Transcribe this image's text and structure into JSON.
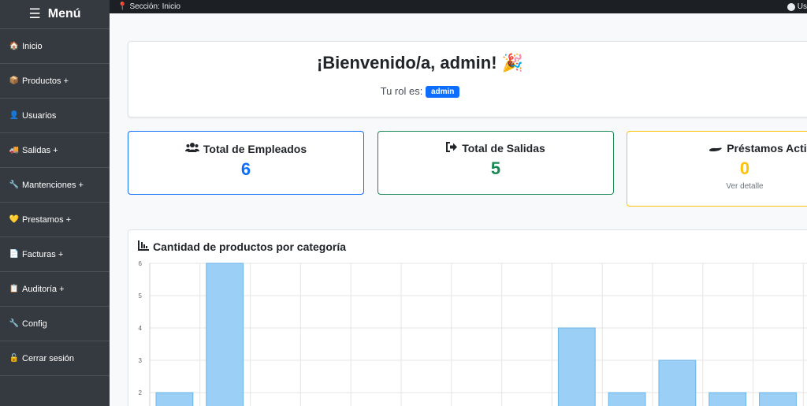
{
  "sidebar": {
    "title": "Menú",
    "items": [
      {
        "emoji": "🏠",
        "label": "Inicio"
      },
      {
        "emoji": "📦",
        "label": "Productos +"
      },
      {
        "emoji": "👤",
        "label": "Usuarios"
      },
      {
        "emoji": "🚚",
        "label": "Salidas +"
      },
      {
        "emoji": "🔧",
        "label": "Mantenciones +"
      },
      {
        "emoji": "💛",
        "label": "Prestamos +"
      },
      {
        "emoji": "📄",
        "label": "Facturas +"
      },
      {
        "emoji": "📋",
        "label": "Auditoría +"
      },
      {
        "emoji": "🔧",
        "label": "Config"
      },
      {
        "emoji": "🔓",
        "label": "Cerrar sesión"
      }
    ]
  },
  "topbar": {
    "section": "Sección: Inicio",
    "user": "Us"
  },
  "welcome": {
    "title": "¡Bienvenido/a, admin!",
    "emoji": "🎉",
    "role_label": "Tu rol es:",
    "role": "admin"
  },
  "cards": {
    "empleados": {
      "title": "Total de Empleados",
      "value": "6",
      "color": "#0d6efd"
    },
    "salidas": {
      "title": "Total de Salidas",
      "value": "5",
      "color": "#198754"
    },
    "prestamos": {
      "title": "Préstamos Activos",
      "value": "0",
      "color": "#ffc107",
      "link": "Ver detalle"
    }
  },
  "chart_title": "Cantidad de productos por categoría",
  "chart_data": {
    "type": "bar",
    "title": "Cantidad de productos por categoría",
    "values": [
      2,
      6,
      0,
      0,
      0,
      0,
      0,
      0,
      4,
      2,
      3,
      2,
      2
    ],
    "yticks": [
      2,
      3,
      4,
      5,
      6
    ],
    "ylim": [
      0,
      6
    ],
    "grid": true,
    "bar_color": "#9ccff5"
  }
}
